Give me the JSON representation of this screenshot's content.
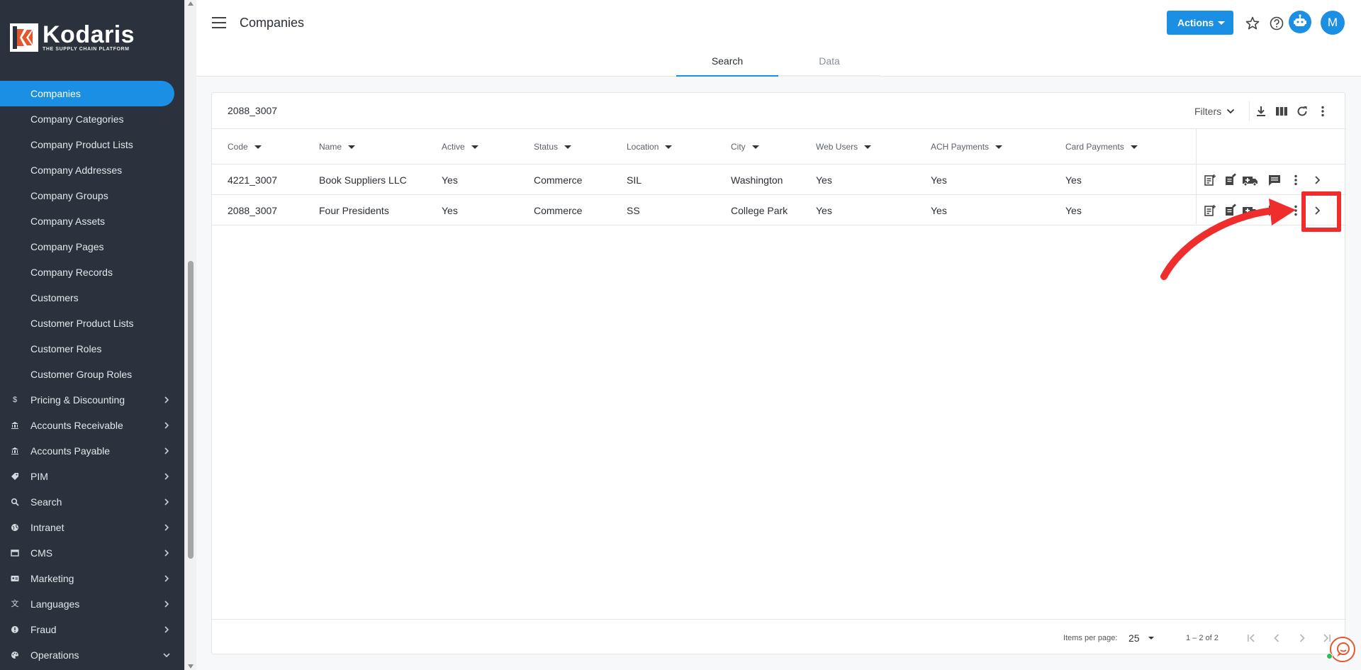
{
  "brand": {
    "name": "Kodaris",
    "tagline": "THE SUPPLY CHAIN PLATFORM",
    "accent": "#1a8fe3",
    "sidebar_bg": "#2b323d"
  },
  "sidebar": {
    "items": [
      {
        "label": "Companies",
        "active": true
      },
      {
        "label": "Company Categories"
      },
      {
        "label": "Company Product Lists"
      },
      {
        "label": "Company Addresses"
      },
      {
        "label": "Company Groups"
      },
      {
        "label": "Company Assets"
      },
      {
        "label": "Company Pages"
      },
      {
        "label": "Company Records"
      },
      {
        "label": "Customers"
      },
      {
        "label": "Customer Product Lists"
      },
      {
        "label": "Customer Roles"
      },
      {
        "label": "Customer Group Roles"
      }
    ],
    "sections": [
      {
        "label": "Pricing & Discounting",
        "icon": "dollar-icon"
      },
      {
        "label": "Accounts Receivable",
        "icon": "bank-icon"
      },
      {
        "label": "Accounts Payable",
        "icon": "bank-icon"
      },
      {
        "label": "PIM",
        "icon": "tag-icon"
      },
      {
        "label": "Search",
        "icon": "search-icon"
      },
      {
        "label": "Intranet",
        "icon": "globe-icon"
      },
      {
        "label": "CMS",
        "icon": "browser-icon"
      },
      {
        "label": "Marketing",
        "icon": "id-card-icon"
      },
      {
        "label": "Languages",
        "icon": "translate-icon"
      },
      {
        "label": "Fraud",
        "icon": "alert-icon"
      },
      {
        "label": "Operations",
        "icon": "palette-icon",
        "expanded": true
      }
    ]
  },
  "header": {
    "title": "Companies",
    "actions_label": "Actions",
    "avatar_initial": "M"
  },
  "tabs": [
    {
      "label": "Search",
      "active": true
    },
    {
      "label": "Data",
      "active": false
    }
  ],
  "search": {
    "value": "2088_3007",
    "filters_label": "Filters"
  },
  "table": {
    "columns": [
      "Code",
      "Name",
      "Active",
      "Status",
      "Location",
      "City",
      "Web Users",
      "ACH Payments",
      "Card Payments"
    ],
    "rows": [
      [
        "4221_3007",
        "Book Suppliers LLC",
        "Yes",
        "Commerce",
        "SIL",
        "Washington",
        "Yes",
        "Yes",
        "Yes"
      ],
      [
        "2088_3007",
        "Four Presidents",
        "Yes",
        "Commerce",
        "SS",
        "College Park",
        "Yes",
        "Yes",
        "Yes"
      ]
    ]
  },
  "pagination": {
    "items_per_page_label": "Items per page:",
    "items_per_page": "25",
    "range": "1 – 2 of 2"
  },
  "annotation": {
    "color": "#f02d2d",
    "target": "row-2-open-button"
  }
}
